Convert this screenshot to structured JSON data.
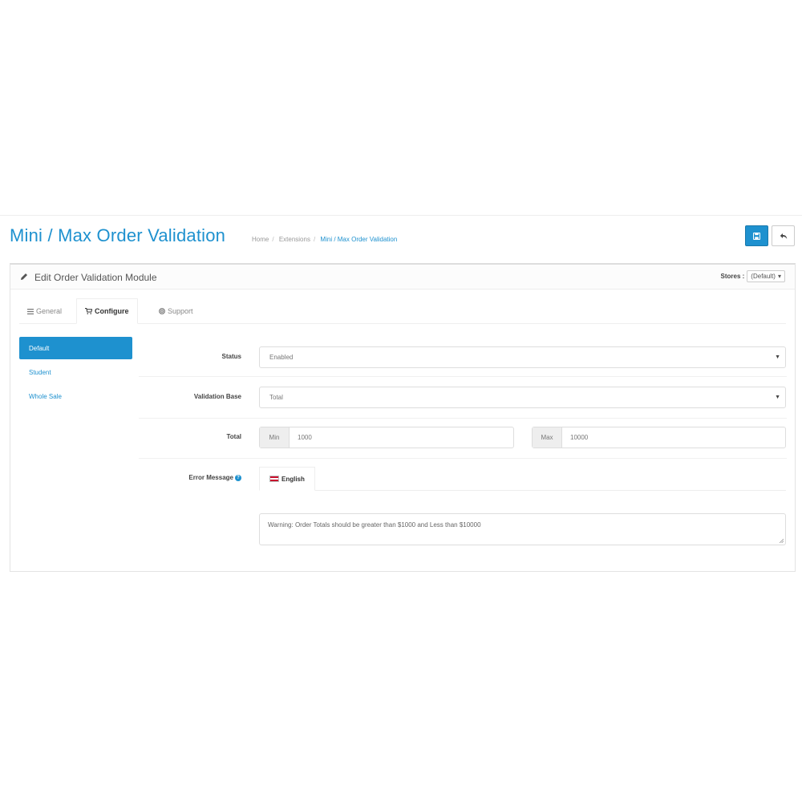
{
  "header": {
    "title": "Mini / Max Order Validation",
    "breadcrumb": [
      "Home",
      "Extensions",
      "Mini / Max Order Validation"
    ],
    "buttons": {
      "save_icon": "save-icon",
      "back_icon": "reply-icon"
    }
  },
  "panel": {
    "title": "Edit Order Validation Module",
    "stores_label": "Stores :",
    "stores_selected": "(Default)"
  },
  "tabs": [
    {
      "label": "General",
      "icon": "list-icon"
    },
    {
      "label": "Configure",
      "icon": "cart-icon"
    },
    {
      "label": "Support",
      "icon": "life-ring-icon"
    }
  ],
  "sidebar": {
    "items": [
      {
        "label": "Default"
      },
      {
        "label": "Student"
      },
      {
        "label": "Whole Sale"
      }
    ]
  },
  "form": {
    "status": {
      "label": "Status",
      "value": "Enabled"
    },
    "validation_base": {
      "label": "Validation Base",
      "value": "Total"
    },
    "total": {
      "label": "Total",
      "min_addon": "Min",
      "min_value": "1000",
      "max_addon": "Max",
      "max_value": "10000"
    },
    "error_message": {
      "label": "Error Message",
      "language": "English",
      "text": "Warning: Order Totals should be greater than $1000 and Less than $10000"
    }
  },
  "colors": {
    "accent": "#1e91cf"
  }
}
